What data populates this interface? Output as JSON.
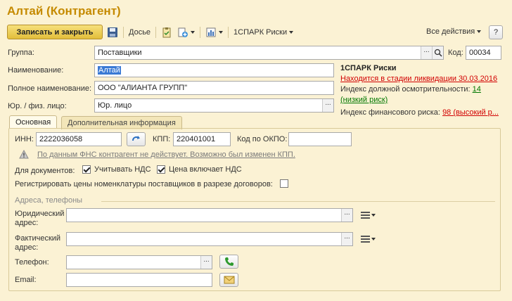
{
  "window": {
    "title": "Алтай (Контрагент)"
  },
  "toolbar": {
    "save_close": "Записать и закрыть",
    "dossier": "Досье",
    "spark": "1СПАРК Риски",
    "all_actions": "Все действия",
    "help": "?"
  },
  "form": {
    "group_label": "Группа:",
    "group_value": "Поставщики",
    "code_label": "Код:",
    "code_value": "00034",
    "name_label": "Наименование:",
    "name_value": "Алтай",
    "fullname_label": "Полное наименование:",
    "fullname_value": "ООО \"АЛИАНТА ГРУПП\"",
    "legal_label": "Юр. / физ. лицо:",
    "legal_value": "Юр. лицо"
  },
  "spark_panel": {
    "title": "1СПАРК Риски",
    "liquidation": "Находится в стадии ликвидации 30.03.2016",
    "due_diligence_label": "Индекс должной осмотрительности:",
    "due_diligence_value": "14",
    "due_diligence_note": "(низкий риск)",
    "financial_label": "Индекс финансового риска:",
    "financial_value": "98 (высокий р..."
  },
  "tabs": {
    "main": "Основная",
    "additional": "Дополнительная информация"
  },
  "main_tab": {
    "inn_label": "ИНН:",
    "inn_value": "2222036058",
    "kpp_label": "КПП:",
    "kpp_value": "220401001",
    "okpo_label": "Код по ОКПО:",
    "okpo_value": "",
    "warning": "По данным ФНС контрагент не действует. Возможно был изменен КПП.",
    "for_docs_label": "Для документов:",
    "vat_label": "Учитывать НДС",
    "vat_checked": true,
    "price_vat_label": "Цена включает НДС",
    "price_vat_checked": true,
    "register_prices_label": "Регистрировать цены номенклатуры поставщиков в разрезе договоров:",
    "register_prices_checked": false,
    "section_title": "Адреса, телефоны",
    "legal_address_label": "Юридический адрес:",
    "legal_address_value": "",
    "actual_address_label": "Фактический адрес:",
    "actual_address_value": "",
    "phone_label": "Телефон:",
    "phone_value": "",
    "email_label": "Email:",
    "email_value": ""
  },
  "colors": {
    "background": "#fbf2d4",
    "title": "#c58a00",
    "accent_button": "#e2be3a",
    "danger": "#d20000",
    "ok": "#007800"
  }
}
